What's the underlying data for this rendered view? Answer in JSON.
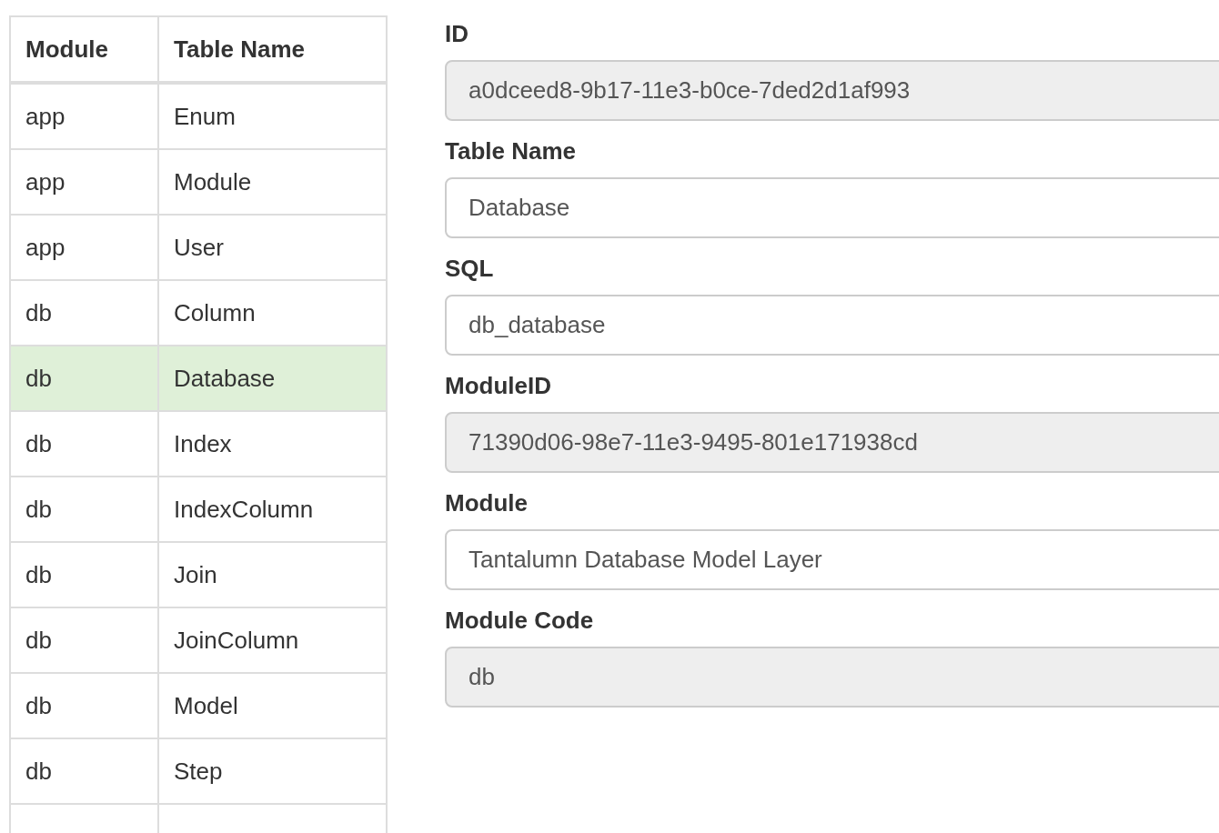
{
  "table": {
    "columns": [
      "Module",
      "Table Name"
    ],
    "rows": [
      {
        "cells": [
          "app",
          "Enum"
        ],
        "selected": false
      },
      {
        "cells": [
          "app",
          "Module"
        ],
        "selected": false
      },
      {
        "cells": [
          "app",
          "User"
        ],
        "selected": false
      },
      {
        "cells": [
          "db",
          "Column"
        ],
        "selected": false
      },
      {
        "cells": [
          "db",
          "Database"
        ],
        "selected": true
      },
      {
        "cells": [
          "db",
          "Index"
        ],
        "selected": false
      },
      {
        "cells": [
          "db",
          "IndexColumn"
        ],
        "selected": false
      },
      {
        "cells": [
          "db",
          "Join"
        ],
        "selected": false
      },
      {
        "cells": [
          "db",
          "JoinColumn"
        ],
        "selected": false
      },
      {
        "cells": [
          "db",
          "Model"
        ],
        "selected": false
      },
      {
        "cells": [
          "db",
          "Step"
        ],
        "selected": false
      }
    ]
  },
  "form": {
    "fields": [
      {
        "label": "ID",
        "value": "a0dceed8-9b17-11e3-b0ce-7ded2d1af993",
        "readonly": true
      },
      {
        "label": "Table Name",
        "value": "Database",
        "readonly": false
      },
      {
        "label": "SQL",
        "value": "db_database",
        "readonly": false
      },
      {
        "label": "ModuleID",
        "value": "71390d06-98e7-11e3-9495-801e171938cd",
        "readonly": true
      },
      {
        "label": "Module",
        "value": "Tantalumn Database Model Layer",
        "readonly": false
      },
      {
        "label": "Module Code",
        "value": "db",
        "readonly": true
      }
    ]
  }
}
